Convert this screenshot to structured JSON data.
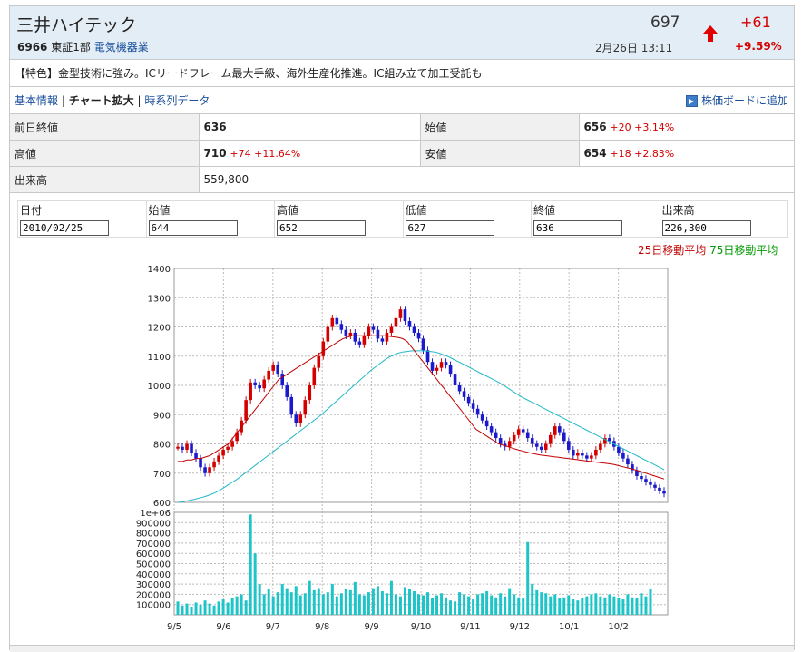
{
  "header": {
    "company_name": "三井ハイテック",
    "code": "6966",
    "market": "東証1部",
    "sector": "電気機器業",
    "price": "697",
    "datetime": "2月26日 13:11",
    "change": "+61",
    "change_pct": "+9.59%"
  },
  "feature_text": "【特色】金型技術に強み。ICリードフレーム最大手級、海外生産化推進。IC組み立て加工受託も",
  "nav": {
    "basic_info": "基本情報",
    "chart_large": "チャート拡大",
    "timeseries": "時系列データ",
    "add_board": "株価ボードに追加"
  },
  "info": {
    "prev_close_label": "前日終値",
    "prev_close": "636",
    "open_label": "始値",
    "open": "656",
    "open_chg": "+20 +3.14%",
    "high_label": "高値",
    "high": "710",
    "high_chg": "+74 +11.64%",
    "low_label": "安値",
    "low": "654",
    "low_chg": "+18 +2.83%",
    "volume_label": "出来高",
    "volume": "559,800"
  },
  "ohlc": {
    "date_label": "日付",
    "date": "2010/02/25",
    "open_label": "始値",
    "open": "644",
    "high_label": "高値",
    "high": "652",
    "low_label": "低値",
    "low": "627",
    "close_label": "終値",
    "close": "636",
    "volume_label": "出来高",
    "volume": "226,300"
  },
  "ma_legend": {
    "ma25": "25日移動平均",
    "ma75": "75日移動平均"
  },
  "colors": {
    "up": "#d40000",
    "down": "#1a1acc",
    "ma25": "#c00000",
    "ma75": "#20b8c8",
    "volume": "#1ec5c8"
  },
  "chart_data": {
    "type": "candlestick",
    "price_ylim": [
      600,
      1400
    ],
    "price_ticks": [
      "600",
      "700",
      "800",
      "900",
      "1000",
      "1100",
      "1200",
      "1300",
      "1400"
    ],
    "volume_ylim": [
      0,
      1000000
    ],
    "volume_ticks": [
      "100000",
      "200000",
      "300000",
      "400000",
      "500000",
      "600000",
      "700000",
      "800000",
      "900000",
      "1e+06"
    ],
    "x_ticks": [
      "9/5",
      "9/6",
      "9/7",
      "9/8",
      "9/9",
      "9/10",
      "9/11",
      "9/12",
      "10/1",
      "10/2"
    ],
    "close_path": [
      790,
      780,
      800,
      770,
      750,
      720,
      700,
      720,
      740,
      760,
      780,
      790,
      810,
      840,
      880,
      950,
      1010,
      1000,
      990,
      1020,
      1050,
      1070,
      1040,
      1000,
      960,
      900,
      870,
      900,
      950,
      1000,
      1060,
      1100,
      1150,
      1200,
      1230,
      1210,
      1190,
      1170,
      1180,
      1150,
      1140,
      1170,
      1200,
      1190,
      1160,
      1150,
      1180,
      1200,
      1230,
      1260,
      1220,
      1200,
      1180,
      1160,
      1120,
      1080,
      1050,
      1060,
      1080,
      1070,
      1040,
      1000,
      980,
      960,
      940,
      920,
      900,
      880,
      860,
      840,
      820,
      800,
      790,
      810,
      830,
      850,
      840,
      820,
      800,
      790,
      780,
      800,
      830,
      860,
      840,
      810,
      780,
      760,
      770,
      760,
      750,
      760,
      780,
      800,
      820,
      810,
      790,
      770,
      750,
      730,
      710,
      690,
      680,
      670,
      660,
      650,
      640,
      630
    ],
    "ma25_path": [
      740,
      740,
      745,
      745,
      750,
      750,
      755,
      760,
      770,
      780,
      790,
      800,
      820,
      840,
      860,
      880,
      900,
      920,
      940,
      960,
      980,
      1000,
      1020,
      1030,
      1040,
      1050,
      1060,
      1070,
      1080,
      1090,
      1100,
      1110,
      1120,
      1130,
      1140,
      1150,
      1160,
      1165,
      1170,
      1170,
      1170,
      1170,
      1170,
      1170,
      1170,
      1170,
      1168,
      1166,
      1164,
      1160,
      1150,
      1130,
      1110,
      1090,
      1070,
      1050,
      1030,
      1010,
      990,
      970,
      950,
      930,
      910,
      890,
      870,
      850,
      840,
      830,
      820,
      810,
      800,
      795,
      790,
      785,
      780,
      776,
      772,
      768,
      765,
      762,
      760,
      758,
      756,
      754,
      752,
      750,
      748,
      746,
      744,
      742,
      740,
      738,
      736,
      734,
      732,
      730,
      726,
      722,
      718,
      714,
      710,
      705,
      700,
      695,
      690,
      685,
      680
    ],
    "ma75_path": [
      600,
      602,
      605,
      608,
      612,
      616,
      620,
      626,
      632,
      640,
      650,
      660,
      670,
      680,
      692,
      704,
      716,
      728,
      740,
      752,
      764,
      776,
      788,
      800,
      812,
      824,
      836,
      848,
      860,
      872,
      884,
      896,
      910,
      924,
      938,
      952,
      966,
      980,
      994,
      1008,
      1022,
      1036,
      1050,
      1062,
      1074,
      1086,
      1096,
      1104,
      1110,
      1114,
      1116,
      1118,
      1118,
      1118,
      1118,
      1116,
      1114,
      1110,
      1104,
      1098,
      1090,
      1082,
      1074,
      1066,
      1058,
      1050,
      1042,
      1034,
      1026,
      1018,
      1010,
      1000,
      990,
      980,
      970,
      960,
      952,
      944,
      936,
      928,
      920,
      912,
      904,
      896,
      888,
      880,
      872,
      864,
      856,
      848,
      840,
      832,
      824,
      816,
      808,
      800,
      792,
      784,
      776,
      768,
      760,
      752,
      744,
      736,
      728,
      720,
      712
    ],
    "volume_path": [
      130000,
      90000,
      110000,
      80000,
      120000,
      100000,
      140000,
      110000,
      90000,
      130000,
      150000,
      120000,
      160000,
      180000,
      200000,
      140000,
      980000,
      600000,
      300000,
      200000,
      250000,
      180000,
      220000,
      300000,
      260000,
      220000,
      280000,
      190000,
      210000,
      330000,
      240000,
      260000,
      200000,
      220000,
      300000,
      180000,
      210000,
      250000,
      240000,
      320000,
      200000,
      190000,
      220000,
      260000,
      280000,
      230000,
      210000,
      330000,
      200000,
      180000,
      270000,
      250000,
      230000,
      200000,
      190000,
      220000,
      160000,
      190000,
      210000,
      170000,
      140000,
      130000,
      220000,
      200000,
      180000,
      150000,
      200000,
      210000,
      230000,
      190000,
      170000,
      210000,
      180000,
      260000,
      200000,
      170000,
      160000,
      710000,
      300000,
      240000,
      220000,
      210000,
      180000,
      200000,
      160000,
      170000,
      190000,
      150000,
      140000,
      160000,
      180000,
      200000,
      210000,
      180000,
      170000,
      200000,
      180000,
      160000,
      150000,
      200000,
      170000,
      160000,
      210000,
      180000,
      250000
    ]
  }
}
